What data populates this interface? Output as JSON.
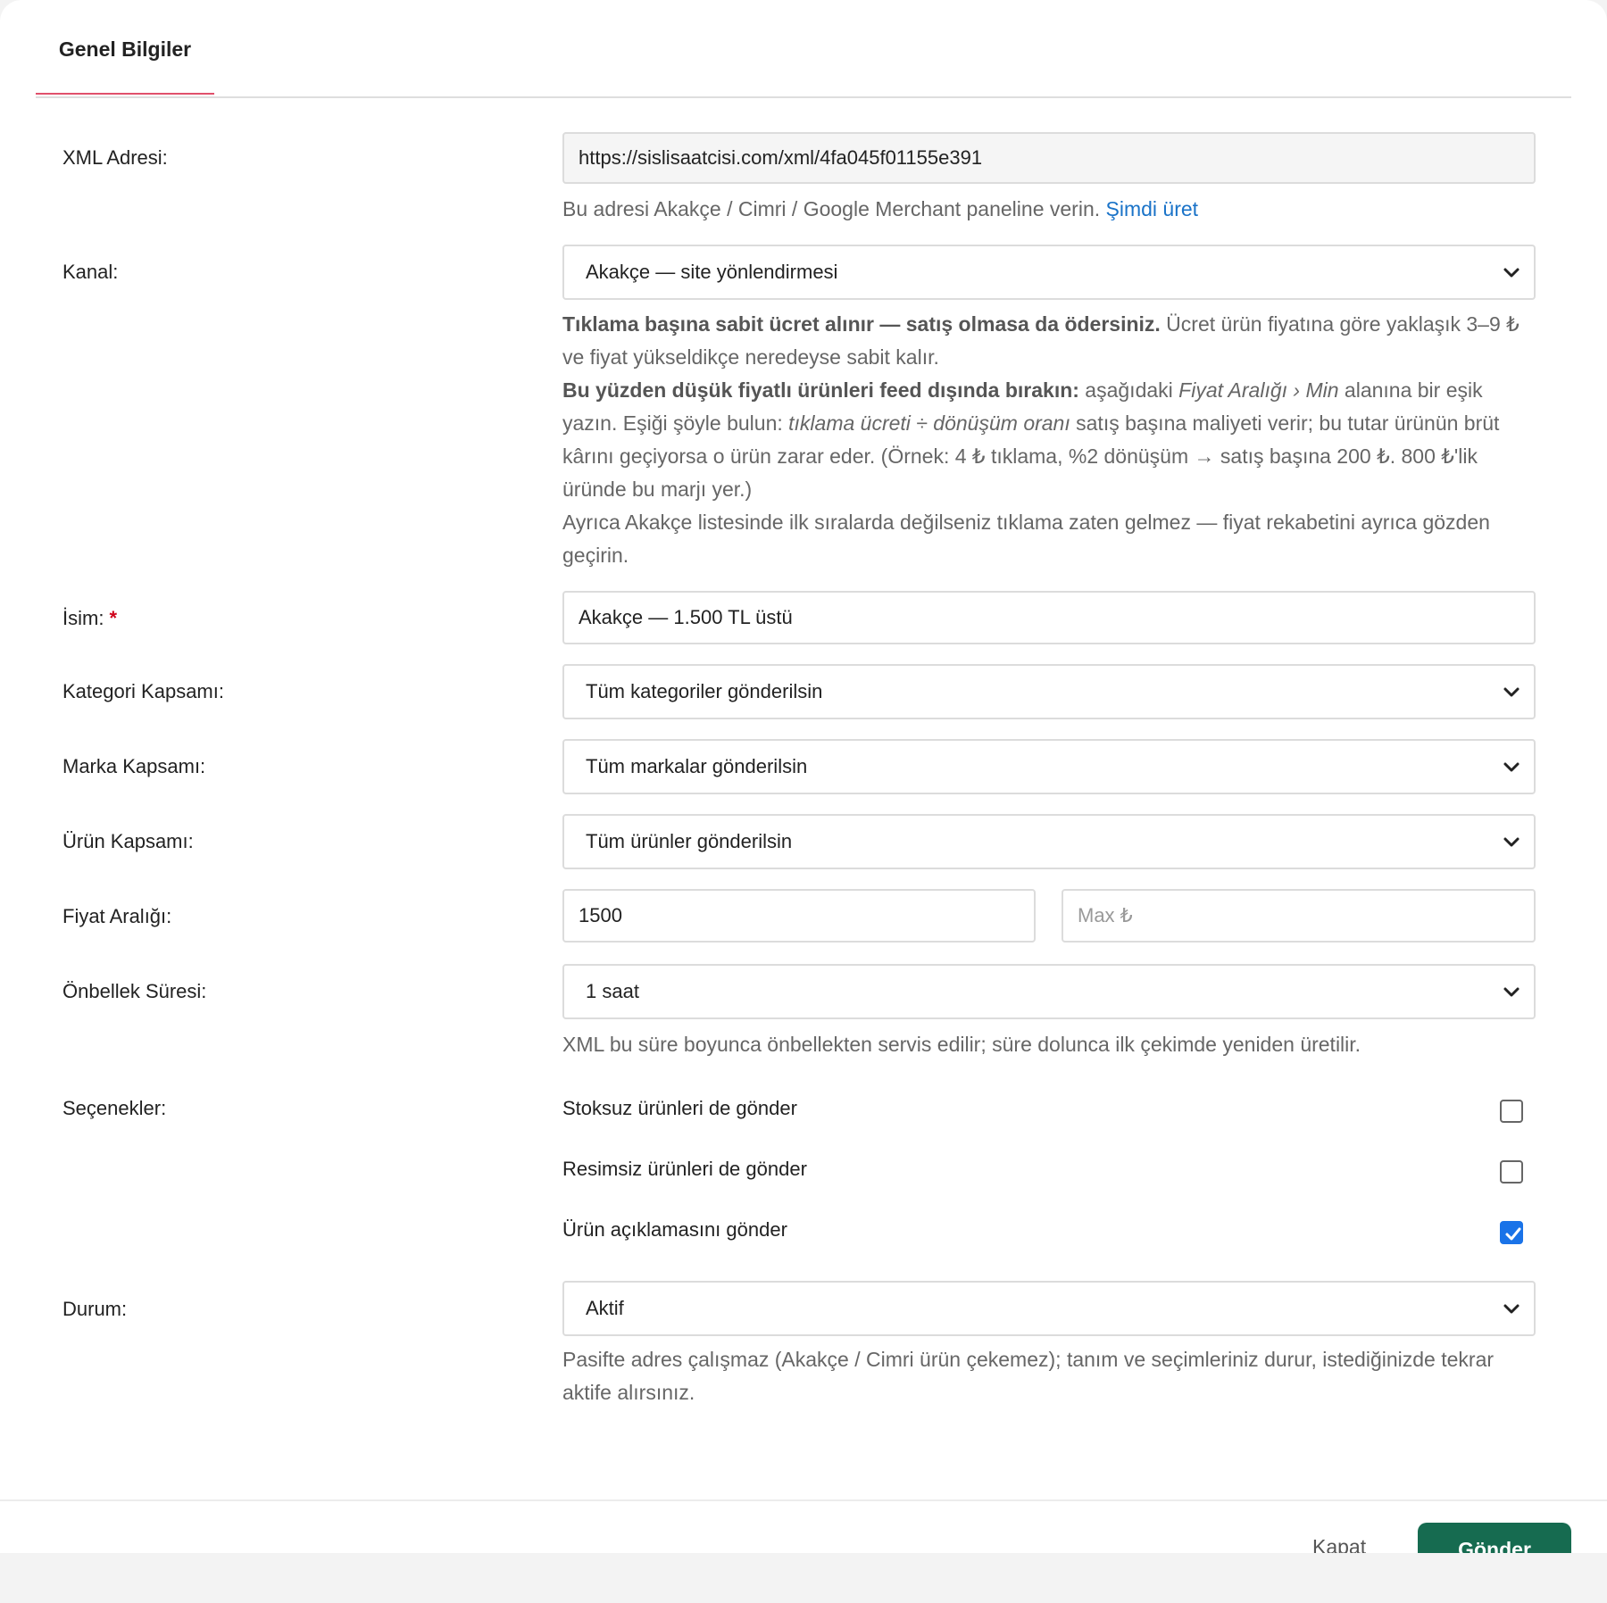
{
  "tab": {
    "label": "Genel Bilgiler"
  },
  "xml": {
    "label": "XML Adresi:",
    "value": "https://sislisaatcisi.com/xml/4fa045f01155e391",
    "help": "Bu adresi Akakçe / Cimri / Google Merchant paneline verin.",
    "help_link": "Şimdi üret"
  },
  "kanal": {
    "label": "Kanal:",
    "value": "Akakçe — site yönlendirmesi",
    "help_p1_bold": "Tıklama başına sabit ücret alınır — satış olmasa da ödersiniz.",
    "help_p1_rest": " Ücret ürün fiyatına göre yaklaşık 3–9 ₺ ve fiyat yükseldikçe neredeyse sabit kalır.",
    "help_p2_bold": "Bu yüzden düşük fiyatlı ürünleri feed dışında bırakın:",
    "help_p2_a": " aşağıdaki ",
    "help_p2_em1": "Fiyat Aralığı › Min",
    "help_p2_b": " alanına bir eşik yazın. Eşiği şöyle bulun: ",
    "help_p2_em2": "tıklama ücreti ÷ dönüşüm oranı",
    "help_p2_c": " satış başına maliyeti verir; bu tutar ürünün brüt kârını geçiyorsa o ürün zarar eder. (Örnek: 4 ₺ tıklama, %2 dönüşüm → satış başına 200 ₺. 800 ₺'lik üründe bu marjı yer.)",
    "help_p3": "Ayrıca Akakçe listesinde ilk sıralarda değilseniz tıklama zaten gelmez — fiyat rekabetini ayrıca gözden geçirin."
  },
  "isim": {
    "label": "İsim:",
    "required": "*",
    "value": "Akakçe — 1.500 TL üstü"
  },
  "kategori": {
    "label": "Kategori Kapsamı:",
    "value": "Tüm kategoriler gönderilsin"
  },
  "marka": {
    "label": "Marka Kapsamı:",
    "value": "Tüm markalar gönderilsin"
  },
  "urun": {
    "label": "Ürün Kapsamı:",
    "value": "Tüm ürünler gönderilsin"
  },
  "fiyat": {
    "label": "Fiyat Aralığı:",
    "min_value": "1500",
    "max_placeholder": "Max ₺"
  },
  "onbellek": {
    "label": "Önbellek Süresi:",
    "value": "1 saat",
    "help": "XML bu süre boyunca önbellekten servis edilir; süre dolunca ilk çekimde yeniden üretilir."
  },
  "secenekler": {
    "label": "Seçenekler:",
    "items": [
      {
        "label": "Stoksuz ürünleri de gönder",
        "checked": false
      },
      {
        "label": "Resimsiz ürünleri de gönder",
        "checked": false
      },
      {
        "label": "Ürün açıklamasını gönder",
        "checked": true
      }
    ]
  },
  "durum": {
    "label": "Durum:",
    "value": "Aktif",
    "help": "Pasifte adres çalışmaz (Akakçe / Cimri ürün çekemez); tanım ve seçimleriniz durur, istediğinizde tekrar aktife alırsınız."
  },
  "footer": {
    "close_label": "Kapat",
    "submit_label": "Gönder"
  },
  "colors": {
    "accent": "#e0506b",
    "link": "#1a73c8",
    "primary_button": "#166b50",
    "checkbox": "#1a73e8"
  }
}
